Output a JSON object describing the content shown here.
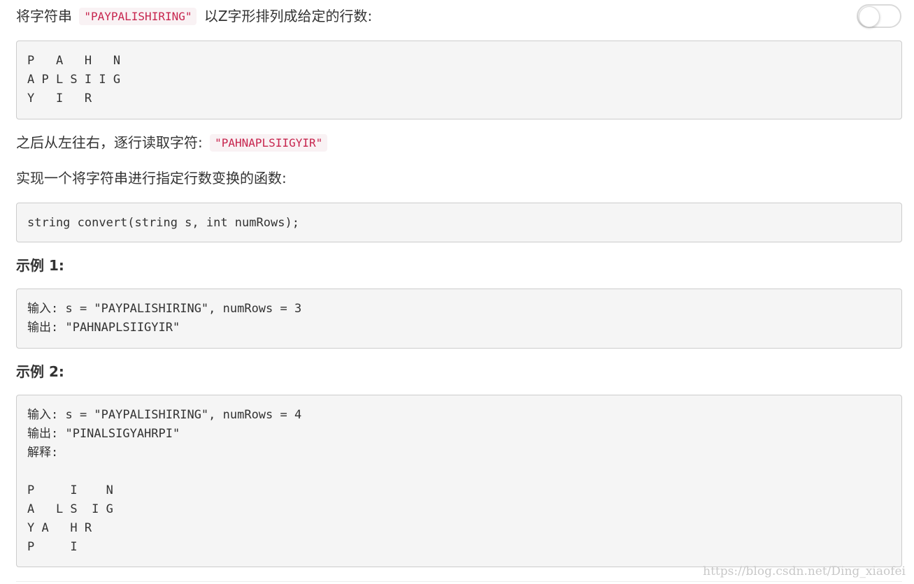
{
  "intro": {
    "prefix": "将字符串",
    "code": "\"PAYPALISHIRING\"",
    "suffix": "以Z字形排列成给定的行数:"
  },
  "toggle": {
    "state": "off"
  },
  "zigzag_3": "P   A   H   N\nA P L S I I G\nY   I   R",
  "read_line": {
    "prefix": "之后从左往右，逐行读取字符:",
    "code": "\"PAHNAPLSIIGYIR\""
  },
  "implement_line": "实现一个将字符串进行指定行数变换的函数:",
  "signature": "string convert(string s, int numRows);",
  "example1": {
    "title": "示例 1:",
    "body": "输入: s = \"PAYPALISHIRING\", numRows = 3\n输出: \"PAHNAPLSIIGYIR\""
  },
  "example2": {
    "title": "示例 2:",
    "body": "输入: s = \"PAYPALISHIRING\", numRows = 4\n输出: \"PINALSIGYAHRPI\"\n解释:\n\nP     I    N\nA   L S  I G\nY A   H R\nP     I"
  },
  "watermark": "https://blog.csdn.net/Ding_xiaofei"
}
